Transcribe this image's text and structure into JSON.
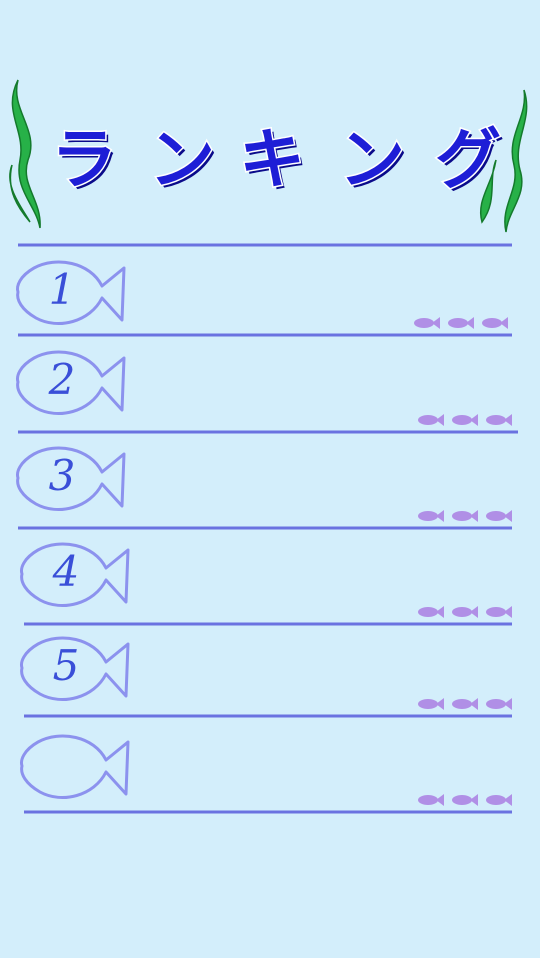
{
  "title": {
    "chars": [
      "ラ",
      "ン",
      "キ",
      "ン",
      "グ"
    ]
  },
  "colors": {
    "background": "#d3eefb",
    "title_fill": "#1e1ed6",
    "title_stroke": "#ffffff",
    "title_shadow": "#0a0a8a",
    "rule_line": "#6a72e0",
    "fish_outline": "#8c92ee",
    "rank_number": "#3a4fd8",
    "small_fish": "#b08fe6",
    "seaweed": "#27b148",
    "seaweed_edge": "#147a2c"
  },
  "rows": [
    {
      "rank": "1",
      "placeholder_dots": [
        "small-fish-icon",
        "small-fish-icon",
        "small-fish-icon"
      ]
    },
    {
      "rank": "2",
      "placeholder_dots": [
        "small-fish-icon",
        "small-fish-icon",
        "small-fish-icon"
      ]
    },
    {
      "rank": "3",
      "placeholder_dots": [
        "small-fish-icon",
        "small-fish-icon",
        "small-fish-icon"
      ]
    },
    {
      "rank": "4",
      "placeholder_dots": [
        "small-fish-icon",
        "small-fish-icon",
        "small-fish-icon"
      ]
    },
    {
      "rank": "5",
      "placeholder_dots": [
        "small-fish-icon",
        "small-fish-icon",
        "small-fish-icon"
      ]
    },
    {
      "rank": "",
      "placeholder_dots": [
        "small-fish-icon",
        "small-fish-icon",
        "small-fish-icon"
      ]
    }
  ]
}
